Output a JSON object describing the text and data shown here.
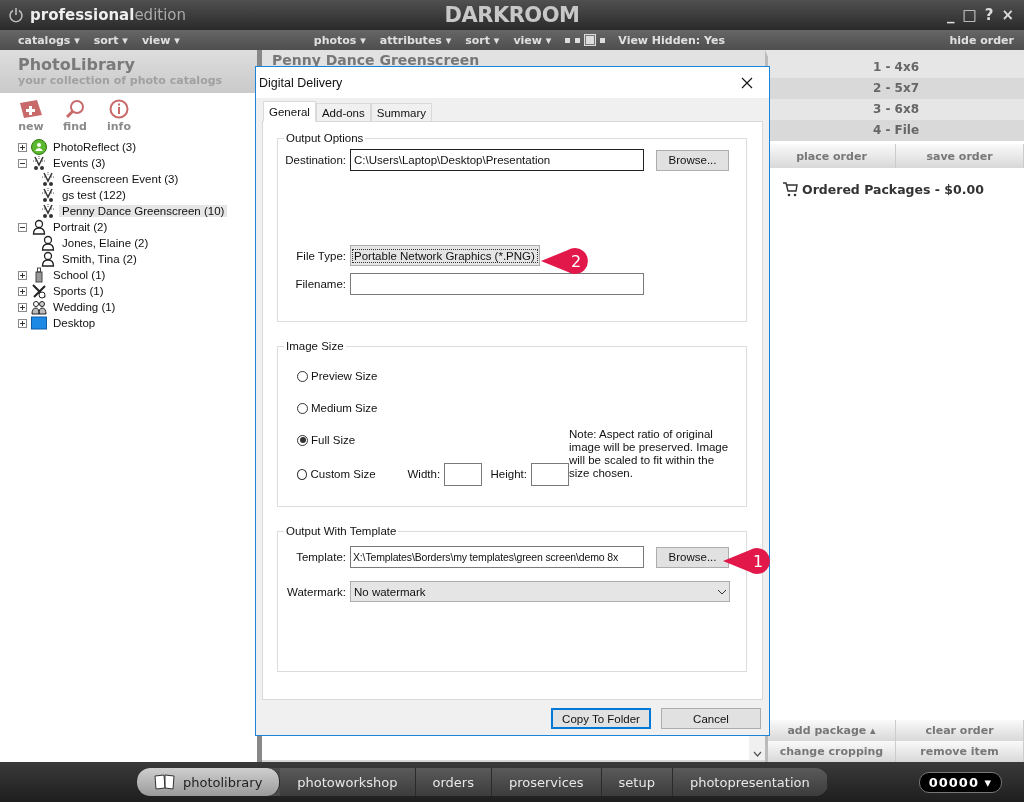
{
  "app": {
    "brand": "**professional**edition",
    "title": "DARKROOM",
    "window_controls": [
      "_",
      "□",
      "?",
      "×"
    ]
  },
  "menu": {
    "left": [
      "catalogs ▾",
      "sort ▾",
      "view ▾"
    ],
    "center": [
      "photos ▾",
      "attributes ▾",
      "sort ▾",
      "view ▾"
    ],
    "view_sizes": [
      {
        "selected": false
      },
      {
        "selected": false
      },
      {
        "selected": true
      },
      {
        "selected": false
      }
    ],
    "view_hidden": "View Hidden: Yes",
    "hide_order": "hide order"
  },
  "library": {
    "title": "PhotoLibrary",
    "subtitle": "your collection of photo catalogs",
    "tools": [
      {
        "kind": "new",
        "label": "new"
      },
      {
        "kind": "find",
        "label": "find"
      },
      {
        "kind": "info",
        "label": "info"
      }
    ],
    "tree": [
      {
        "kind": "photoreflect",
        "label": "PhotoReflect (3)",
        "expanded": false,
        "selected": false
      },
      {
        "kind": "event",
        "label": "Events (3)",
        "expanded": true,
        "selected": false,
        "children": [
          {
            "kind": "event",
            "label": "Greenscreen Event (3)",
            "selected": false
          },
          {
            "kind": "event",
            "label": "gs test (122)",
            "selected": false
          },
          {
            "kind": "event",
            "label": "Penny Dance Greenscreen (10)",
            "selected": true
          }
        ]
      },
      {
        "kind": "portrait",
        "label": "Portrait (2)",
        "expanded": true,
        "selected": false,
        "children": [
          {
            "kind": "portrait",
            "label": "Jones, Elaine (2)",
            "selected": false
          },
          {
            "kind": "portrait",
            "label": "Smith, Tina (2)",
            "selected": false
          }
        ]
      },
      {
        "kind": "school",
        "label": "School (1)",
        "expanded": false,
        "selected": false
      },
      {
        "kind": "sports",
        "label": "Sports (1)",
        "expanded": false,
        "selected": false
      },
      {
        "kind": "wedding",
        "label": "Wedding (1)",
        "expanded": false,
        "selected": false
      },
      {
        "kind": "desktop",
        "label": "Desktop",
        "expanded": false,
        "selected": false
      }
    ]
  },
  "center": {
    "title": "Penny Dance Greenscreen"
  },
  "order": {
    "packages": [
      "1 - 4x6",
      "2 - 5x7",
      "3 - 6x8",
      "4 - File"
    ],
    "actions": [
      "place order",
      "save order"
    ],
    "ordered": "Ordered Packages - $0.00",
    "bottom_actions": [
      "add package ▴",
      "clear order",
      "change cropping",
      "remove item"
    ]
  },
  "bottom_tabs": [
    {
      "label": "photolibrary",
      "selected": true
    },
    {
      "label": "photoworkshop",
      "selected": false
    },
    {
      "label": "orders",
      "selected": false
    },
    {
      "label": "proservices",
      "selected": false
    },
    {
      "label": "setup",
      "selected": false
    },
    {
      "label": "photopresentation",
      "selected": false
    }
  ],
  "counter": "00000 ▾",
  "dialog": {
    "title": "Digital Delivery",
    "tabs": [
      {
        "label": "General",
        "selected": true
      },
      {
        "label": "Add-ons",
        "selected": false
      },
      {
        "label": "Summary",
        "selected": false
      }
    ],
    "output_options": {
      "legend": "Output Options",
      "destination_label": "Destination:",
      "destination_value": "C:\\Users\\Laptop\\Desktop\\Presentation",
      "browse": "Browse...",
      "file_type_label": "File Type:",
      "file_type_value": "Portable Network Graphics (*.PNG)",
      "filename_label": "Filename:"
    },
    "image_size": {
      "legend": "Image Size",
      "options": [
        {
          "kind": "plain",
          "label": "Preview Size",
          "selected": false
        },
        {
          "kind": "plain",
          "label": "Medium Size",
          "selected": false
        },
        {
          "kind": "plain",
          "label": "Full Size",
          "selected": true
        },
        {
          "kind": "custom",
          "label": "Custom Size",
          "selected": false
        }
      ],
      "width_label": "Width:",
      "height_label": "Height:",
      "note": "Note: Aspect ratio of original image will be preserved. Image will be scaled to fit within the size chosen."
    },
    "template": {
      "legend": "Output With Template",
      "template_label": "Template:",
      "template_value": "X:\\Templates\\Borders\\my templates\\green screen\\demo 8x",
      "browse": "Browse...",
      "watermark_label": "Watermark:",
      "watermark_value": "No watermark"
    },
    "buttons": [
      {
        "label": "Copy To Folder",
        "default": true
      },
      {
        "label": "Cancel",
        "default": false
      }
    ]
  },
  "callouts": [
    {
      "label": "2"
    },
    {
      "label": "1"
    }
  ]
}
